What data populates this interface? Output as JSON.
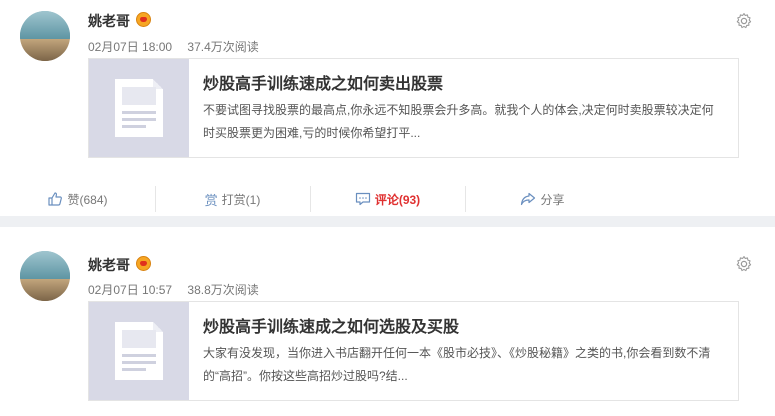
{
  "posts": [
    {
      "author": "姚老哥",
      "date": "02月07日 18:00",
      "views": "37.4万次阅读",
      "article": {
        "title": "炒股高手训练速成之如何卖出股票",
        "desc": "不要试图寻找股票的最高点,你永远不知股票会升多高。就我个人的体会,决定何时卖股票较决定何时买股票更为困难,亏的时候你希望打平..."
      },
      "actions": {
        "like": "赞(684)",
        "tip": "打赏(1)",
        "comment": "评论(93)",
        "share": "分享"
      }
    },
    {
      "author": "姚老哥",
      "date": "02月07日 10:57",
      "views": "38.8万次阅读",
      "article": {
        "title": "炒股高手训练速成之如何选股及买股",
        "desc": "大家有没发现，当你进入书店翻开任何一本《股市必技》、《炒股秘籍》之类的书,你会看到数不清的“高招”。你按这些高招炒过股吗?结..."
      }
    }
  ],
  "colors": {
    "accent_red": "#e03131",
    "vip_gold": "#f6a623",
    "thumb_bg": "#d8d9e6"
  },
  "icons": [
    "gear-icon",
    "thumbs-up-icon",
    "tip-icon",
    "comment-icon",
    "share-icon",
    "vip-badge-icon",
    "document-placeholder-icon"
  ]
}
